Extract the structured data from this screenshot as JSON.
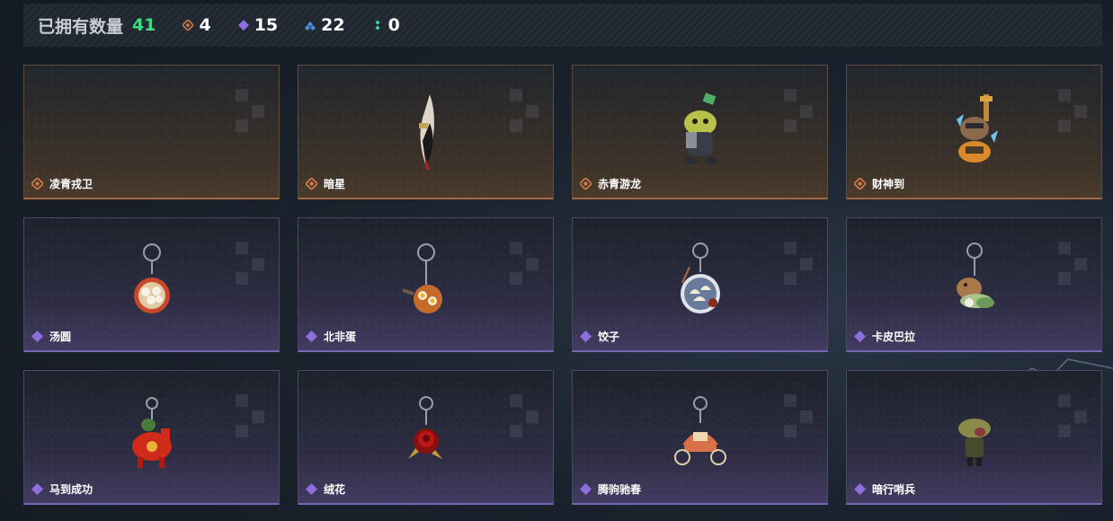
{
  "header": {
    "owned_label": "已拥有数量",
    "owned_count": "41",
    "rarity_counts": [
      {
        "icon": "orange-gem-icon",
        "color": "#d07a45",
        "count": "4"
      },
      {
        "icon": "purple-gem-icon",
        "color": "#8f6fe0",
        "count": "15"
      },
      {
        "icon": "blue-gem-icon",
        "color": "#4c8fe0",
        "count": "22"
      },
      {
        "icon": "green-gem-icon",
        "color": "#3ddc9c",
        "count": "0"
      }
    ]
  },
  "items": [
    {
      "name": "凌青戎卫",
      "rarity": "orange",
      "icon": "empty"
    },
    {
      "name": "暗星",
      "rarity": "orange",
      "icon": "feather-blade-charm-icon"
    },
    {
      "name": "赤青游龙",
      "rarity": "orange",
      "icon": "green-dragon-figure-icon"
    },
    {
      "name": "财神到",
      "rarity": "orange",
      "icon": "fortune-god-figure-icon"
    },
    {
      "name": "汤圆",
      "rarity": "purple",
      "icon": "tangyuan-bowl-charm-icon"
    },
    {
      "name": "北非蛋",
      "rarity": "purple",
      "icon": "shakshuka-pan-charm-icon"
    },
    {
      "name": "饺子",
      "rarity": "purple",
      "icon": "dumpling-plate-charm-icon"
    },
    {
      "name": "卡皮巴拉",
      "rarity": "purple",
      "icon": "capybara-charm-icon"
    },
    {
      "name": "马到成功",
      "rarity": "purple",
      "icon": "red-horse-charm-icon"
    },
    {
      "name": "绒花",
      "rarity": "purple",
      "icon": "red-rose-charm-icon"
    },
    {
      "name": "腾驹驰春",
      "rarity": "purple",
      "icon": "carriage-charm-icon"
    },
    {
      "name": "暗行哨兵",
      "rarity": "purple",
      "icon": "camo-soldier-charm-icon"
    }
  ],
  "colors": {
    "orange_gem": "#d07a45",
    "purple_gem": "#8f6fe0",
    "owned_count": "#3ddc84"
  }
}
